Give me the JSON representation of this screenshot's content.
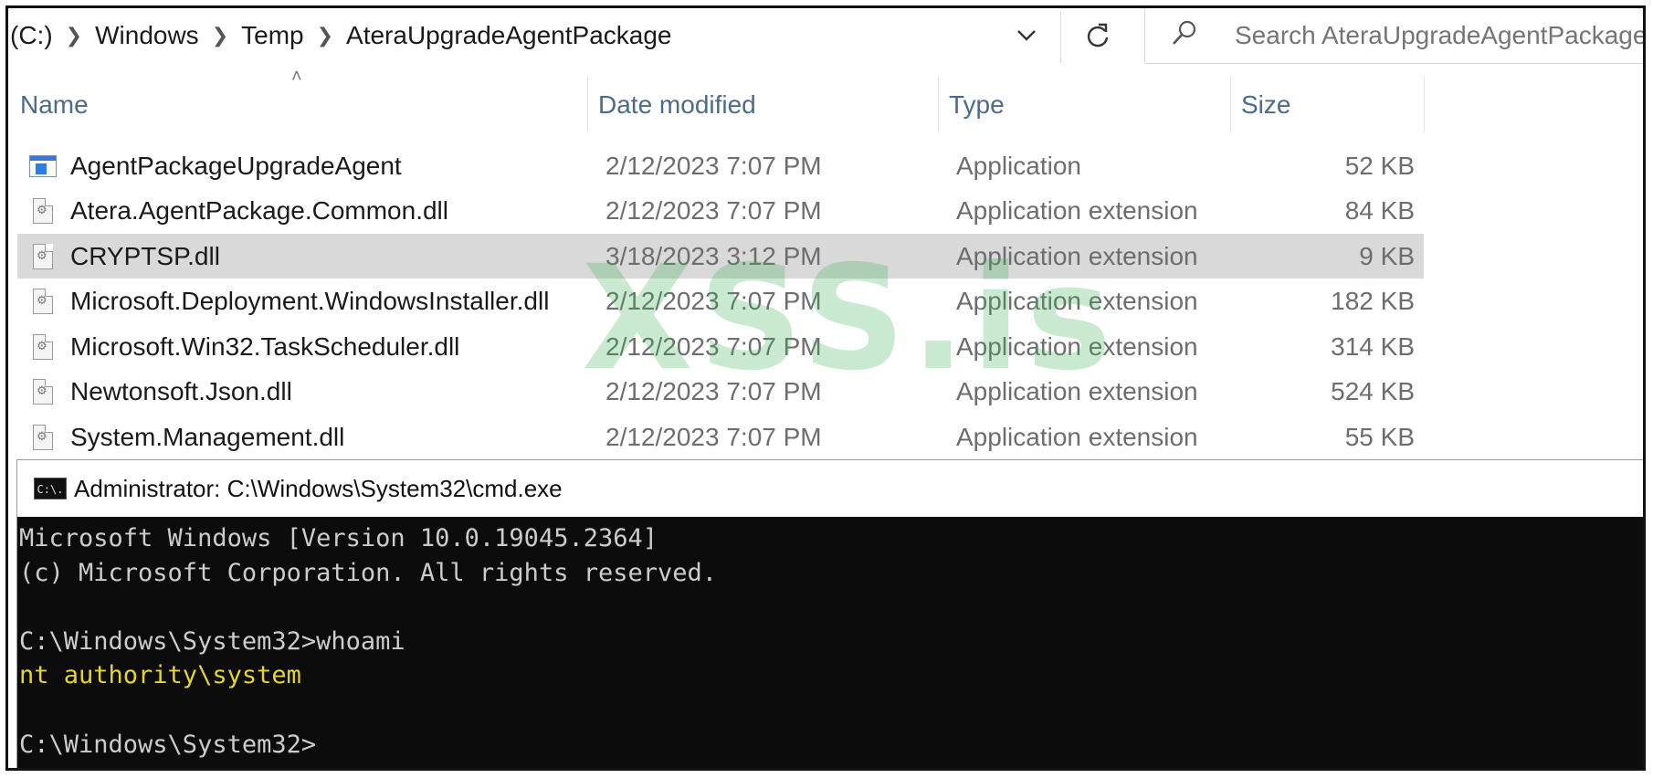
{
  "address_bar": {
    "breadcrumb": [
      "(C:)",
      "Windows",
      "Temp",
      "AteraUpgradeAgentPackage"
    ],
    "search_placeholder": "Search AteraUpgradeAgentPackage"
  },
  "columns": {
    "name": "Name",
    "date_modified": "Date modified",
    "type": "Type",
    "size": "Size"
  },
  "files": [
    {
      "name": "AgentPackageUpgradeAgent",
      "date": "2/12/2023 7:07 PM",
      "type": "Application",
      "size": "52 KB",
      "icon": "application-icon",
      "selected": false
    },
    {
      "name": "Atera.AgentPackage.Common.dll",
      "date": "2/12/2023 7:07 PM",
      "type": "Application extension",
      "size": "84 KB",
      "icon": "dll-file-icon",
      "selected": false
    },
    {
      "name": "CRYPTSP.dll",
      "date": "3/18/2023 3:12 PM",
      "type": "Application extension",
      "size": "9 KB",
      "icon": "dll-file-icon",
      "selected": true
    },
    {
      "name": "Microsoft.Deployment.WindowsInstaller.dll",
      "date": "2/12/2023 7:07 PM",
      "type": "Application extension",
      "size": "182 KB",
      "icon": "dll-file-icon",
      "selected": false
    },
    {
      "name": "Microsoft.Win32.TaskScheduler.dll",
      "date": "2/12/2023 7:07 PM",
      "type": "Application extension",
      "size": "314 KB",
      "icon": "dll-file-icon",
      "selected": false
    },
    {
      "name": "Newtonsoft.Json.dll",
      "date": "2/12/2023 7:07 PM",
      "type": "Application extension",
      "size": "524 KB",
      "icon": "dll-file-icon",
      "selected": false
    },
    {
      "name": "System.Management.dll",
      "date": "2/12/2023 7:07 PM",
      "type": "Application extension",
      "size": "55 KB",
      "icon": "dll-file-icon",
      "selected": false
    }
  ],
  "watermark": "XSS.is",
  "cmd": {
    "title": "Administrator: C:\\Windows\\System32\\cmd.exe",
    "icon_label": "C:\\.",
    "lines": [
      {
        "text": "Microsoft Windows [Version 10.0.19045.2364]",
        "highlight": false
      },
      {
        "text": "(c) Microsoft Corporation. All rights reserved.",
        "highlight": false
      },
      {
        "text": "",
        "highlight": false
      },
      {
        "text": "C:\\Windows\\System32>whoami",
        "highlight": false
      },
      {
        "text": "nt authority\\system",
        "highlight": true
      },
      {
        "text": "",
        "highlight": false
      },
      {
        "text": "C:\\Windows\\System32>",
        "highlight": false
      }
    ]
  },
  "colors": {
    "header_text": "#4b6a8c",
    "selected_row": "#d9d9d9",
    "console_bg": "#0c0c0c",
    "console_text": "#cccccc",
    "console_highlight": "#e6d52a",
    "watermark": "#3cb45a"
  }
}
